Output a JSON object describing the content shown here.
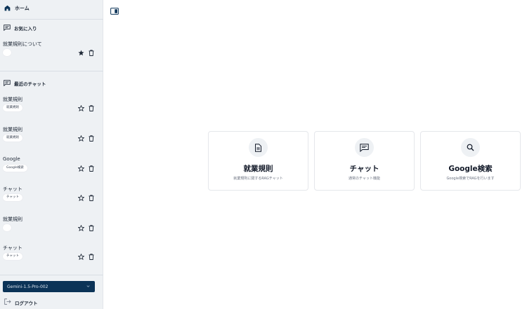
{
  "sidebar": {
    "home_label": "ホーム",
    "favorites_label": "お気に入り",
    "favorites": [
      {
        "title": "就業規則について",
        "badge": ""
      }
    ],
    "recent_label": "最近のチャット",
    "recent": [
      {
        "title": "就業規則",
        "badge": "就業規則"
      },
      {
        "title": "就業規則",
        "badge": "就業規則"
      },
      {
        "title": "Google",
        "badge": "Google検索"
      },
      {
        "title": "チャット",
        "badge": "チャット"
      },
      {
        "title": "就業規則",
        "badge": ""
      },
      {
        "title": "チャット",
        "badge": "チャット"
      }
    ],
    "model_select": "Gemini-1.5-Pro-002",
    "logout_label": "ログアウト"
  },
  "cards": [
    {
      "title": "就業規則",
      "desc": "就業規則に関するRAGチャット",
      "icon": "document-icon"
    },
    {
      "title": "チャット",
      "desc": "通常のチャット機能",
      "icon": "chat-icon"
    },
    {
      "title": "Google検索",
      "desc": "Google検索でRAGを行います",
      "icon": "search-icon"
    }
  ],
  "colors": {
    "sidebar_bg": "#eef1f4",
    "accent": "#0b3357",
    "home_icon": "#0b3357"
  }
}
